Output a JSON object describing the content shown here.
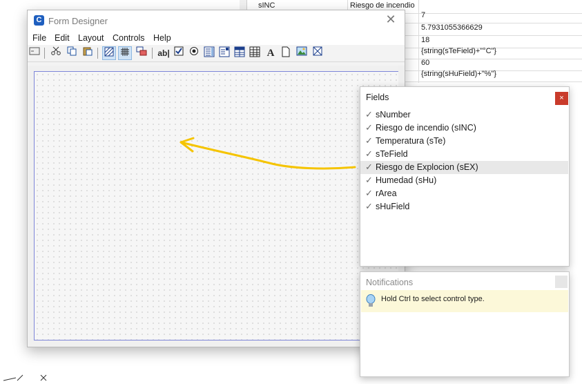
{
  "background_table": {
    "rows": [
      [
        "sINC",
        "Riesgo de incendio",
        ""
      ],
      [
        "",
        "",
        "7"
      ],
      [
        "",
        "",
        "5.7931055366629"
      ],
      [
        "",
        "",
        "18"
      ],
      [
        "",
        "",
        "{string(sTeField)+\"°C\"}"
      ],
      [
        "",
        "",
        "60"
      ],
      [
        "",
        "",
        "{string(sHuField)+\"%\"}"
      ]
    ]
  },
  "window": {
    "app_icon_letter": "C",
    "title": "Form Designer",
    "close": "✕",
    "menu": [
      "File",
      "Edit",
      "Layout",
      "Controls",
      "Help"
    ]
  },
  "toolbar": {
    "icons": [
      "form-properties-icon",
      "cut-icon",
      "copy-icon",
      "paste-icon",
      "show-grid-icon",
      "snap-grid-icon",
      "tab-order-icon",
      "textbox-tool-icon",
      "checkbox-tool-icon",
      "radio-tool-icon",
      "list-tool-icon",
      "combo-tool-icon",
      "table-tool-icon",
      "grid-tool-icon",
      "label-tool-icon",
      "frame-tool-icon",
      "image-tool-icon",
      "box-tool-icon"
    ],
    "textbox_glyph": "ab|",
    "label_glyph": "A"
  },
  "fields_panel": {
    "title": "Fields",
    "close": "×",
    "items": [
      "sNumber",
      "Riesgo de incendio (sINC)",
      "Temperatura (sTe)",
      "sTeField",
      "Riesgo de Explocion (sEX)",
      "Humedad (sHu)",
      "rArea",
      "sHuField"
    ],
    "selected_index": 4
  },
  "notifications": {
    "title": "Notifications",
    "message": "Hold Ctrl to select control type."
  },
  "annotation": {
    "arrow_color": "#f5c400"
  }
}
